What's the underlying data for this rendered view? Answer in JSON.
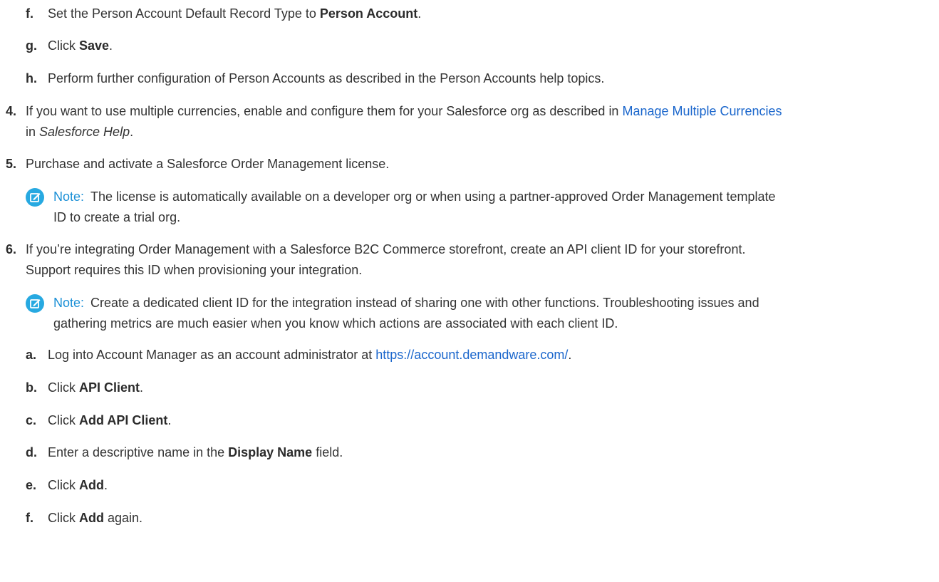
{
  "steps": {
    "f1": {
      "marker": "f.",
      "prefix": "Set the Person Account Default Record Type to ",
      "bold": "Person Account",
      "suffix": "."
    },
    "g1": {
      "marker": "g.",
      "prefix": "Click ",
      "bold": "Save",
      "suffix": "."
    },
    "h1": {
      "marker": "h.",
      "text": "Perform further configuration of Person Accounts as described in the Person Accounts help topics."
    },
    "s4": {
      "marker": "4.",
      "text_before_link": "If you want to use multiple currencies, enable and configure them for your Salesforce org as described in ",
      "link": "Manage Multiple Currencies",
      "line2_prefix": "in ",
      "line2_italic": "Salesforce Help",
      "line2_suffix": "."
    },
    "s5": {
      "marker": "5.",
      "text": "Purchase and activate a Salesforce Order Management license."
    },
    "note1": {
      "label": "Note:",
      "line1": "The license is automatically available on a developer org or when using a partner-approved Order Management template",
      "line2": "ID to create a trial org."
    },
    "s6": {
      "marker": "6.",
      "line1": "If you’re integrating Order Management with a Salesforce B2C Commerce storefront, create an API client ID for your storefront.",
      "line2": "Support requires this ID when provisioning your integration."
    },
    "note2": {
      "label": "Note:",
      "line1": "Create a dedicated client ID for the integration instead of sharing one with other functions. Troubleshooting issues and",
      "line2": "gathering metrics are much easier when you know which actions are associated with each client ID."
    },
    "a": {
      "marker": "a.",
      "prefix": "Log into Account Manager as an account administrator at ",
      "link": "https://account.demandware.com/",
      "suffix": "."
    },
    "b": {
      "marker": "b.",
      "prefix": "Click ",
      "bold": "API Client",
      "suffix": "."
    },
    "c": {
      "marker": "c.",
      "prefix": "Click ",
      "bold": "Add API Client",
      "suffix": "."
    },
    "d": {
      "marker": "d.",
      "prefix": "Enter a descriptive name in the ",
      "bold": "Display Name",
      "suffix": " field."
    },
    "e": {
      "marker": "e.",
      "prefix": "Click ",
      "bold": "Add",
      "suffix": "."
    },
    "f2": {
      "marker": "f.",
      "prefix": "Click ",
      "bold": "Add",
      "suffix": " again."
    }
  },
  "colors": {
    "link": "#1a66cc",
    "note_label": "#1a8fd6",
    "note_icon": "#27a9e1",
    "text": "#333333"
  },
  "icons": {
    "note": "edit-note-icon"
  }
}
